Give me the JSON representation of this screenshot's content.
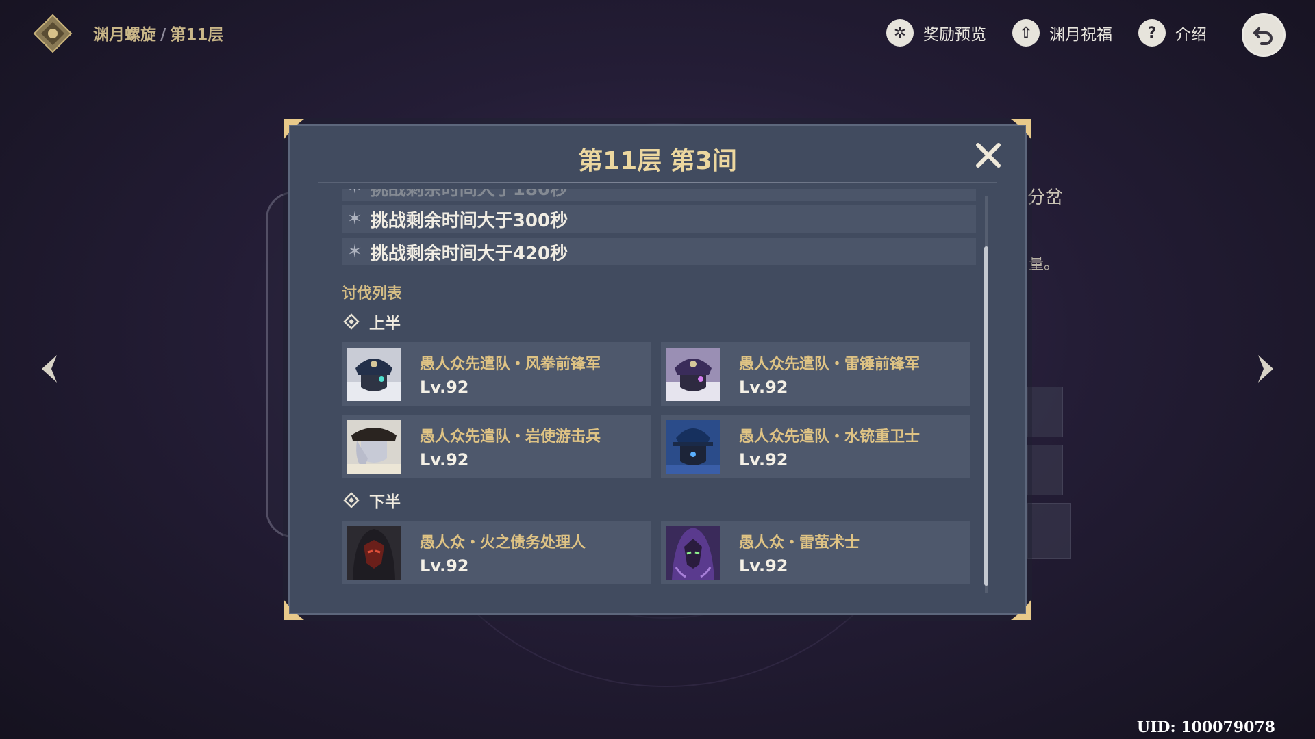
{
  "header": {
    "breadcrumb_root": "渊月螺旋",
    "breadcrumb_sep": "/",
    "breadcrumb_current": "第11层",
    "actions": [
      {
        "label": "奖励预览",
        "icon": "reward-icon"
      },
      {
        "label": "渊月祝福",
        "icon": "blessing-icon"
      },
      {
        "label": "介绍",
        "icon": "help-icon"
      }
    ]
  },
  "background": {
    "peek_text": "分岔",
    "peek_text2": "量。"
  },
  "modal": {
    "title": "第11层 第3间",
    "conditions": [
      {
        "text": "挑战剩余时间大于180秒",
        "faded": true
      },
      {
        "text": "挑战剩余时间大于300秒"
      },
      {
        "text": "挑战剩余时间大于420秒"
      }
    ],
    "enemy_list_label": "讨伐列表",
    "first_half": {
      "label": "上半",
      "enemies": [
        {
          "name": "愚人众先遣队・风拳前锋军",
          "level": "Lv.92"
        },
        {
          "name": "愚人众先遣队・雷锤前锋军",
          "level": "Lv.92"
        },
        {
          "name": "愚人众先遣队・岩使游击兵",
          "level": "Lv.92"
        },
        {
          "name": "愚人众先遣队・水铳重卫士",
          "level": "Lv.92"
        }
      ]
    },
    "second_half": {
      "label": "下半",
      "enemies": [
        {
          "name": "愚人众・火之债务处理人",
          "level": "Lv.92"
        },
        {
          "name": "愚人众・雷萤术士",
          "level": "Lv.92"
        }
      ]
    }
  },
  "uid": "UID: 100079078",
  "colors": {
    "gold": "#ecd79f",
    "panel": "#414b5f",
    "card": "#4e586c",
    "row": "#4b5569"
  }
}
